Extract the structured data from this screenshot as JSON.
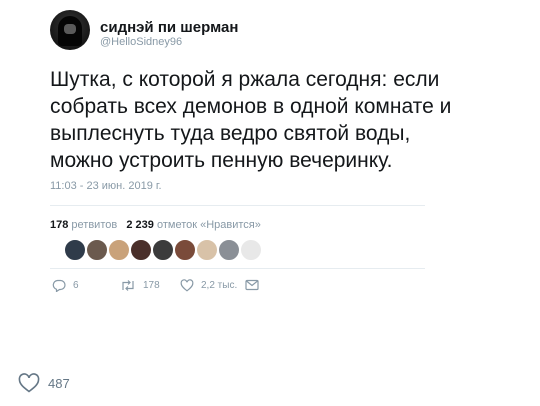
{
  "tweet": {
    "display_name": "сиднэй пи шерман",
    "handle": "@HelloSidney96",
    "lines": [
      "Шутка, с которой я ржала сегодня: если",
      "собрать всех демонов в одной комнате и",
      "выплеснуть туда ведро святой воды,",
      "можно устроить пенную вечеринку."
    ],
    "timestamp": "11:03 - 23 июн. 2019 г.",
    "retweets_count": "178",
    "retweets_label": "ретвитов",
    "likes_count": "2 239",
    "likes_label": "отметок «Нравится»",
    "likers": [
      {
        "color": "#2f3b4a"
      },
      {
        "color": "#6b5a4e"
      },
      {
        "color": "#c9a27a"
      },
      {
        "color": "#4a2f2a"
      },
      {
        "color": "#3b3b3b"
      },
      {
        "color": "#7a4b3a"
      },
      {
        "color": "#d8c2a8"
      },
      {
        "color": "#8a8f96"
      },
      {
        "color": "#e8e8e8"
      }
    ],
    "actions": {
      "reply_count": "6",
      "retweet_count": "178",
      "like_count": "2,2 тыс."
    },
    "icons": {
      "reply": "reply-icon",
      "retweet": "retweet-icon",
      "like": "heart-icon",
      "dm": "envelope-icon"
    }
  },
  "post_footer": {
    "like_count": "487",
    "icon": "heart-icon"
  }
}
